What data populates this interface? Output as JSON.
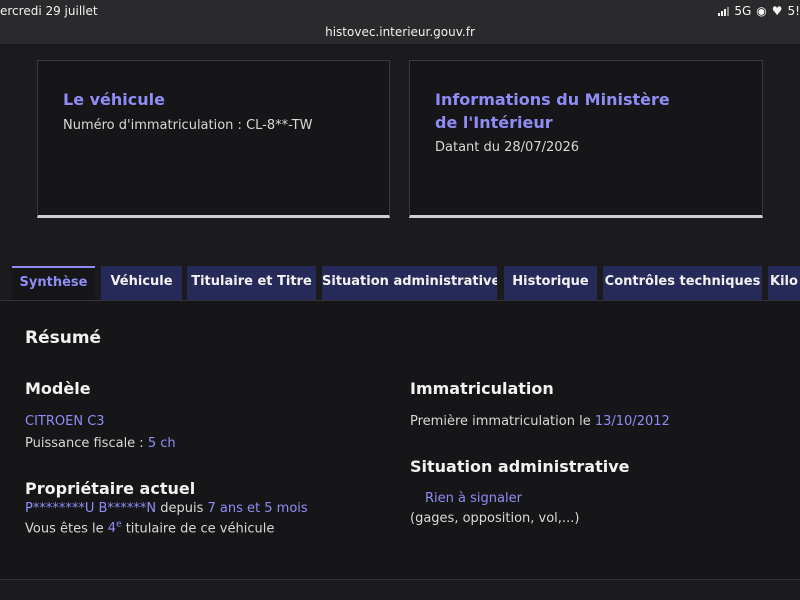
{
  "status_bar": {
    "date": "ercredi 29 juillet",
    "network": "5G",
    "battery": "5!"
  },
  "browser": {
    "url": "histovec.interieur.gouv.fr"
  },
  "vehicle_card": {
    "title": "Le véhicule",
    "plate_label": "Numéro d'immatriculation : ",
    "plate_value": "CL-8**-TW"
  },
  "ministry_card": {
    "title": "Informations du Ministère de l'Intérieur",
    "date_text": "Datant du 28/07/2026"
  },
  "tabs": [
    {
      "label": "Synthèse",
      "active": true
    },
    {
      "label": "Véhicule",
      "active": false
    },
    {
      "label": "Titulaire et Titre",
      "active": false
    },
    {
      "label": "Situation administrative",
      "active": false
    },
    {
      "label": "Historique",
      "active": false
    },
    {
      "label": "Contrôles techniques",
      "active": false
    },
    {
      "label": "Kilo",
      "active": false
    }
  ],
  "summary": {
    "title": "Résumé",
    "model": {
      "heading": "Modèle",
      "name": "CITROEN C3",
      "power_label": "Puissance fiscale : ",
      "power_value": "5 ch"
    },
    "owner": {
      "heading": "Propriétaire actuel",
      "name": "P********U B******N",
      "since_word": " depuis ",
      "duration": "7 ans et 5 mois",
      "rank_prefix": "Vous êtes le ",
      "rank_number": "4",
      "rank_sup": "e",
      "rank_suffix": " titulaire de ce véhicule"
    },
    "registration": {
      "heading": "Immatriculation",
      "first_label": "Première immatriculation le ",
      "first_date": "13/10/2012"
    },
    "admin": {
      "heading": "Situation administrative",
      "status": "Rien à signaler",
      "details": "(gages, opposition, vol,...)"
    }
  },
  "colors": {
    "accent": "#8f8df5",
    "tab_bg": "#262a58",
    "background": "#1b1b1d",
    "panel": "#161618"
  }
}
